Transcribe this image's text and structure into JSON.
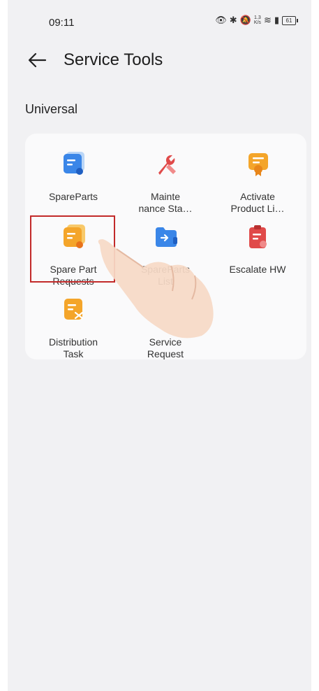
{
  "status_bar": {
    "time": "09:11",
    "net_speed_top": "1.3",
    "net_speed_bottom": "K/s",
    "battery": "61"
  },
  "header": {
    "title": "Service Tools"
  },
  "section": {
    "title": "Universal"
  },
  "tiles": [
    {
      "line1": "SpareParts",
      "line2": "",
      "icon": "spare-parts-icon"
    },
    {
      "line1": "Mainte",
      "line2": "nance Sta…",
      "icon": "maintenance-icon"
    },
    {
      "line1": "Activate",
      "line2": "Product Li…",
      "icon": "certificate-icon"
    },
    {
      "line1": "Spare Part",
      "line2": "Requests",
      "icon": "spare-part-requests-icon"
    },
    {
      "line1": "SpareParts",
      "line2": "List",
      "icon": "folder-icon"
    },
    {
      "line1": "Escalate HW",
      "line2": "",
      "icon": "clipboard-icon"
    },
    {
      "line1": "Distribution",
      "line2": "Task",
      "icon": "distribution-task-icon"
    },
    {
      "line1": "Service",
      "line2": "Request",
      "icon": "service-request-icon"
    }
  ],
  "colors": {
    "accent_red": "#c22a2a",
    "icon_blue": "#3a86e8",
    "icon_orange": "#f4a52a",
    "icon_red": "#e04a4a"
  }
}
